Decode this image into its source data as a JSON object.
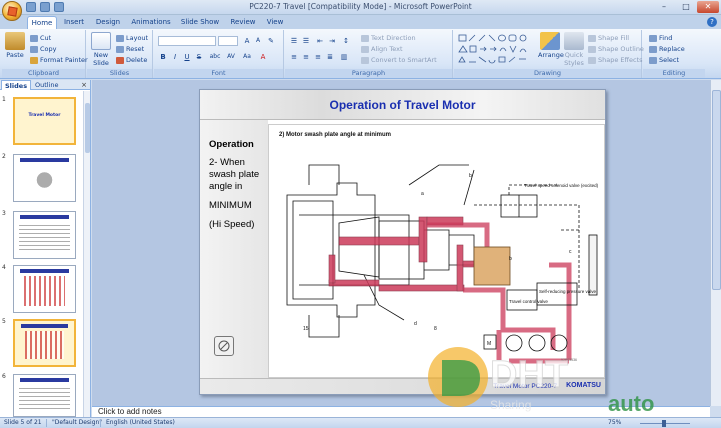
{
  "window": {
    "title": "PC220-7 Travel [Compatibility Mode] - Microsoft PowerPoint",
    "controls": [
      "–",
      "□",
      "✕"
    ]
  },
  "tabs": [
    "Home",
    "Insert",
    "Design",
    "Animations",
    "Slide Show",
    "Review",
    "View"
  ],
  "active_tab": "Home",
  "ribbon": {
    "clipboard": {
      "paste": "Paste",
      "cut": "Cut",
      "copy": "Copy",
      "format_painter": "Format Painter",
      "label": "Clipboard"
    },
    "slides": {
      "new_slide": "New Slide",
      "new_slide_arrow": "▾",
      "layout": "Layout",
      "reset": "Reset",
      "delete": "Delete",
      "label": "Slides"
    },
    "font": {
      "label": "Font",
      "bold": "B",
      "italic": "I",
      "underline": "U",
      "strike": "S",
      "shadow": "abc",
      "spacing": "AV",
      "case": "Aa",
      "grow": "A",
      "shrink": "A"
    },
    "paragraph": {
      "label": "Paragraph",
      "text_direction": "Text Direction",
      "align_text": "Align Text",
      "convert_smartart": "Convert to SmartArt"
    },
    "drawing": {
      "label": "Drawing",
      "arrange": "Arrange",
      "quick_styles": "Quick Styles",
      "shape_fill": "Shape Fill",
      "shape_outline": "Shape Outline",
      "shape_effects": "Shape Effects"
    },
    "editing": {
      "label": "Editing",
      "find": "Find",
      "replace": "Replace",
      "select": "Select"
    }
  },
  "panel": {
    "tab_slides": "Slides",
    "tab_outline": "Outline",
    "close": "×",
    "thumbs": [
      {
        "num": "1",
        "caption": "Travel Motor",
        "selected": false
      },
      {
        "num": "2",
        "caption": "",
        "selected": false
      },
      {
        "num": "3",
        "caption": "",
        "selected": false
      },
      {
        "num": "4",
        "caption": "",
        "selected": false
      },
      {
        "num": "5",
        "caption": "",
        "selected": true
      },
      {
        "num": "6",
        "caption": "",
        "selected": false
      }
    ]
  },
  "slide": {
    "title": "Operation of Travel Motor",
    "heading": "Operation",
    "body_lines": [
      "2- When",
      "swash plate",
      "angle in",
      "MINIMUM",
      "(Hi Speed)"
    ],
    "diagram_heading": "2)  Motor swash plate angle at minimum",
    "diagram_labels": {
      "solenoid": "Travel speed solenoid valve (excited)",
      "control_valve": "Travel control valve",
      "reducing_valve": "Self-reducing pressure valve",
      "m": "M",
      "code": "52P03536",
      "numbers": [
        "15",
        "d",
        "8",
        "b",
        "a",
        "b",
        "c"
      ]
    },
    "footer_text": "Travel Motor PC220-7",
    "footer_brand": "KOMATSU"
  },
  "notes_placeholder": "Click to add notes",
  "status": {
    "slide_info": "Slide 5 of 21",
    "theme": "\"Default Design\"",
    "language": "English (United States)",
    "zoom": "75%"
  },
  "watermark": {
    "text_main": "DHT",
    "text_auto": "auto",
    "tagline": "Sharing"
  },
  "colors": {
    "accent_blue": "#1a2fb0",
    "ribbon": "#d9e6f7",
    "selected_thumb": "#f2b43a",
    "hydraulic_red": "#c0334d"
  }
}
